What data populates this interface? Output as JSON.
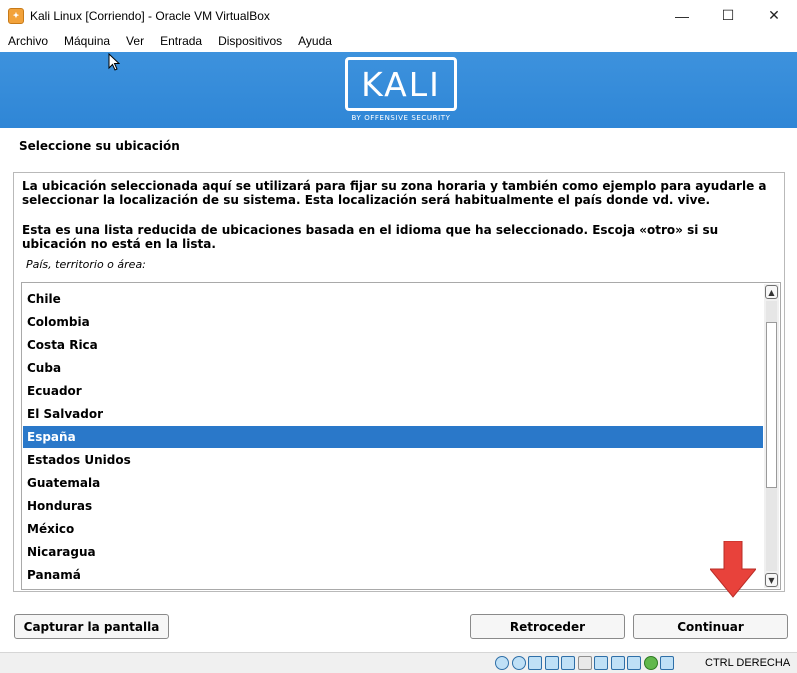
{
  "window": {
    "title": "Kali Linux [Corriendo] - Oracle VM VirtualBox",
    "controls": {
      "minimize": "—",
      "maximize": "☐",
      "close": "✕"
    }
  },
  "menu": [
    "Archivo",
    "Máquina",
    "Ver",
    "Entrada",
    "Dispositivos",
    "Ayuda"
  ],
  "banner": {
    "logo_text": "KALI",
    "tagline": "BY OFFENSIVE SECURITY",
    "color": "#3a90db"
  },
  "installer": {
    "title": "Seleccione su ubicación",
    "paragraph1_line1": "La ubicación seleccionada aquí se utilizará para fijar su zona horaria y también como ejemplo para ayudarle a",
    "paragraph1_line2": "seleccionar la localización de su sistema. Esta localización será habitualmente el país donde vd. vive.",
    "paragraph2_line1": "Esta es una lista reducida de ubicaciones basada en el idioma que ha seleccionado. Escoja «otro» si su",
    "paragraph2_line2": "ubicación no está en la lista.",
    "list_label": "País, territorio o área:",
    "countries": [
      "Chile",
      "Colombia",
      "Costa Rica",
      "Cuba",
      "Ecuador",
      "El Salvador",
      "España",
      "Estados Unidos",
      "Guatemala",
      "Honduras",
      "México",
      "Nicaragua",
      "Panamá"
    ],
    "selected": "España",
    "selection_color": "#2a78c9"
  },
  "buttons": {
    "screenshot": "Capturar la pantalla",
    "back": "Retroceder",
    "continue": "Continuar"
  },
  "statusbar": {
    "icons": [
      "hard-disk-icon",
      "optical-drive-icon",
      "audio-icon",
      "network-icon",
      "usb-icon",
      "shared-folders-icon",
      "display-icon",
      "recording-icon",
      "cpu-icon",
      "mouse-integration-icon",
      "keyboard-icon"
    ],
    "host_key": "CTRL DERECHA"
  },
  "annotation_color": "#e8423b"
}
